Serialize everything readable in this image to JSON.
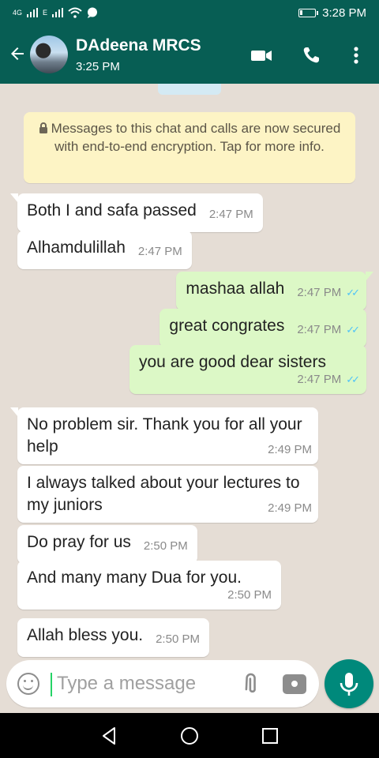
{
  "status_bar": {
    "network_1": "4G",
    "network_2": "E",
    "time": "3:28 PM",
    "battery_level": 0.15
  },
  "header": {
    "contact_name": "DAdeena MRCS",
    "last_seen": "3:25 PM",
    "icons": [
      "back-arrow-icon",
      "video-call-icon",
      "voice-call-icon",
      "more-options-icon"
    ],
    "color": "#075e54"
  },
  "encryption_notice": "Messages to this chat and calls are now secured with end-to-end encryption. Tap for more info.",
  "messages": [
    {
      "direction": "in",
      "text": "Both I and safa passed",
      "time": "2:47 PM"
    },
    {
      "direction": "in",
      "text": "Alhamdulillah",
      "time": "2:47 PM"
    },
    {
      "direction": "out",
      "text": "mashaa allah",
      "time": "2:47 PM",
      "status": "read"
    },
    {
      "direction": "out",
      "text": "great congrates",
      "time": "2:47 PM",
      "status": "read"
    },
    {
      "direction": "out",
      "text": "you are good dear sisters",
      "time": "2:47 PM",
      "status": "read"
    },
    {
      "direction": "in",
      "text": "No problem sir. Thank you for all your help",
      "time": "2:49 PM"
    },
    {
      "direction": "in",
      "text": "I always talked about your lectures to my juniors",
      "time": "2:49 PM"
    },
    {
      "direction": "in",
      "text": "Do pray for us",
      "time": "2:50 PM"
    },
    {
      "direction": "in",
      "text": "And many many Dua for you.",
      "time": "2:50 PM"
    },
    {
      "direction": "in",
      "text": "Allah bless you.",
      "time": "2:50 PM"
    }
  ],
  "composer": {
    "placeholder": "Type a message",
    "icons": [
      "emoji-icon",
      "attach-icon",
      "camera-icon",
      "mic-icon"
    ]
  },
  "colors": {
    "chat_background": "#e5ddd5",
    "outgoing_bubble": "#dcf8c6",
    "incoming_bubble": "#ffffff",
    "read_ticks": "#4fc3f7",
    "accent": "#00897b"
  }
}
